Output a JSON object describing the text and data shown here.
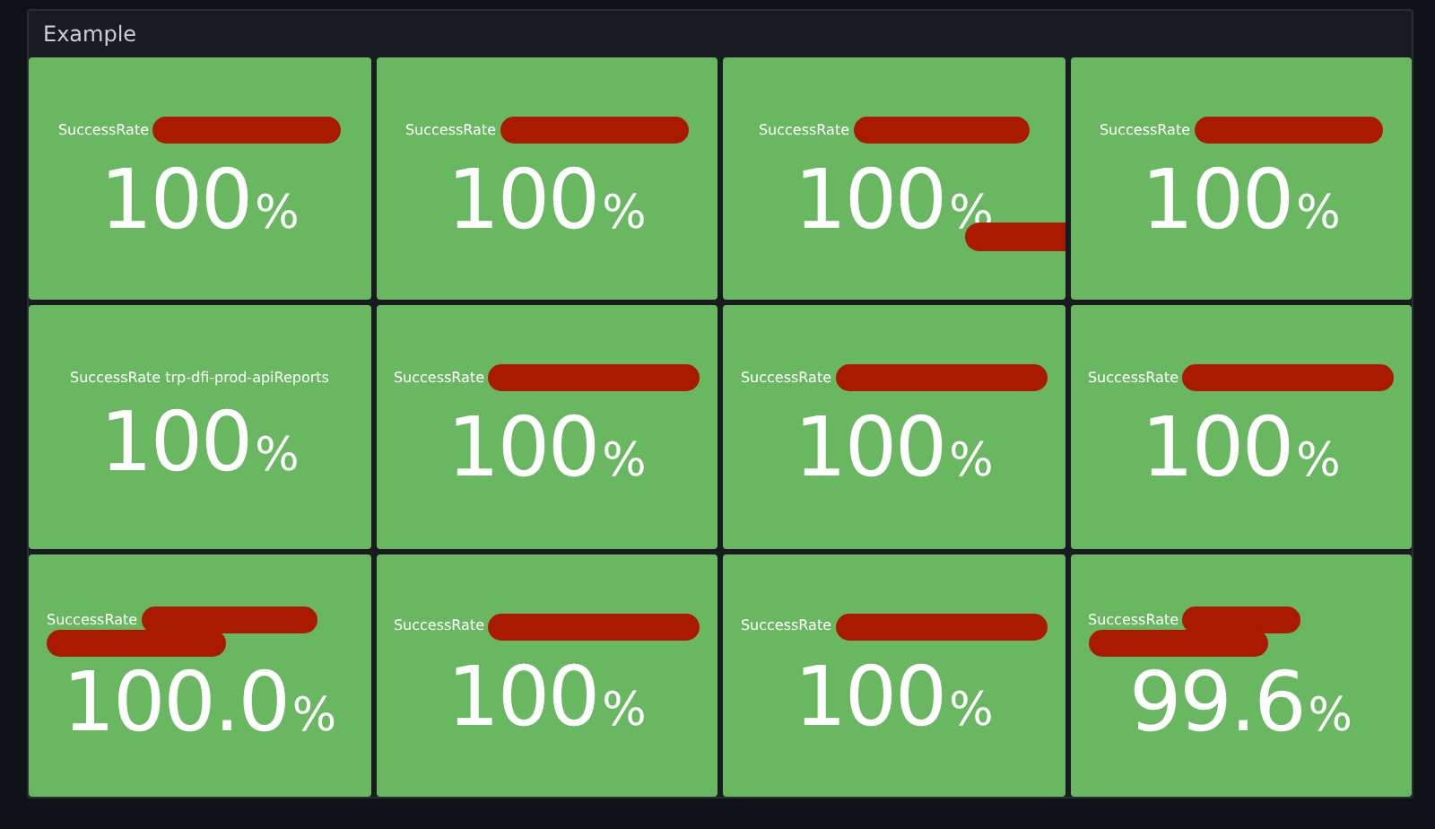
{
  "panel": {
    "title": "Example"
  },
  "tiles": [
    {
      "title": "SuccessRate",
      "value": "100",
      "unit": "%",
      "kind": "inline"
    },
    {
      "title": "SuccessRate",
      "value": "100",
      "unit": "%",
      "kind": "inline"
    },
    {
      "title": "SuccessRate",
      "value": "100",
      "unit": "%",
      "kind": "extra"
    },
    {
      "title": "SuccessRate",
      "value": "100",
      "unit": "%",
      "kind": "inline"
    },
    {
      "title": "SuccessRate trp-dfi-prod-apiReports",
      "value": "100",
      "unit": "%",
      "kind": "plain"
    },
    {
      "title": "SuccessRate",
      "value": "100",
      "unit": "%",
      "kind": "wide"
    },
    {
      "title": "SuccessRate",
      "value": "100",
      "unit": "%",
      "kind": "wide"
    },
    {
      "title": "SuccessRate",
      "value": "100",
      "unit": "%",
      "kind": "wide"
    },
    {
      "title": "SuccessRate",
      "value": "100.0",
      "unit": "%",
      "kind": "split"
    },
    {
      "title": "SuccessRate",
      "value": "100",
      "unit": "%",
      "kind": "wide"
    },
    {
      "title": "SuccessRate",
      "value": "100",
      "unit": "%",
      "kind": "wide"
    },
    {
      "title": "SuccessRate",
      "value": "99.6",
      "unit": "%",
      "kind": "short"
    }
  ]
}
